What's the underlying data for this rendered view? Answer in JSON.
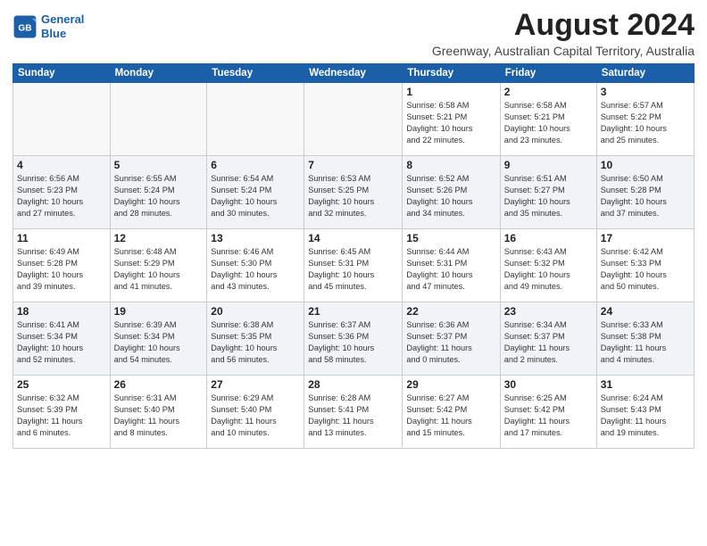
{
  "title": "August 2024",
  "subtitle": "Greenway, Australian Capital Territory, Australia",
  "logo": {
    "line1": "General",
    "line2": "Blue"
  },
  "days_of_week": [
    "Sunday",
    "Monday",
    "Tuesday",
    "Wednesday",
    "Thursday",
    "Friday",
    "Saturday"
  ],
  "weeks": [
    [
      {
        "day": "",
        "info": ""
      },
      {
        "day": "",
        "info": ""
      },
      {
        "day": "",
        "info": ""
      },
      {
        "day": "",
        "info": ""
      },
      {
        "day": "1",
        "info": "Sunrise: 6:58 AM\nSunset: 5:21 PM\nDaylight: 10 hours\nand 22 minutes."
      },
      {
        "day": "2",
        "info": "Sunrise: 6:58 AM\nSunset: 5:21 PM\nDaylight: 10 hours\nand 23 minutes."
      },
      {
        "day": "3",
        "info": "Sunrise: 6:57 AM\nSunset: 5:22 PM\nDaylight: 10 hours\nand 25 minutes."
      }
    ],
    [
      {
        "day": "4",
        "info": "Sunrise: 6:56 AM\nSunset: 5:23 PM\nDaylight: 10 hours\nand 27 minutes."
      },
      {
        "day": "5",
        "info": "Sunrise: 6:55 AM\nSunset: 5:24 PM\nDaylight: 10 hours\nand 28 minutes."
      },
      {
        "day": "6",
        "info": "Sunrise: 6:54 AM\nSunset: 5:24 PM\nDaylight: 10 hours\nand 30 minutes."
      },
      {
        "day": "7",
        "info": "Sunrise: 6:53 AM\nSunset: 5:25 PM\nDaylight: 10 hours\nand 32 minutes."
      },
      {
        "day": "8",
        "info": "Sunrise: 6:52 AM\nSunset: 5:26 PM\nDaylight: 10 hours\nand 34 minutes."
      },
      {
        "day": "9",
        "info": "Sunrise: 6:51 AM\nSunset: 5:27 PM\nDaylight: 10 hours\nand 35 minutes."
      },
      {
        "day": "10",
        "info": "Sunrise: 6:50 AM\nSunset: 5:28 PM\nDaylight: 10 hours\nand 37 minutes."
      }
    ],
    [
      {
        "day": "11",
        "info": "Sunrise: 6:49 AM\nSunset: 5:28 PM\nDaylight: 10 hours\nand 39 minutes."
      },
      {
        "day": "12",
        "info": "Sunrise: 6:48 AM\nSunset: 5:29 PM\nDaylight: 10 hours\nand 41 minutes."
      },
      {
        "day": "13",
        "info": "Sunrise: 6:46 AM\nSunset: 5:30 PM\nDaylight: 10 hours\nand 43 minutes."
      },
      {
        "day": "14",
        "info": "Sunrise: 6:45 AM\nSunset: 5:31 PM\nDaylight: 10 hours\nand 45 minutes."
      },
      {
        "day": "15",
        "info": "Sunrise: 6:44 AM\nSunset: 5:31 PM\nDaylight: 10 hours\nand 47 minutes."
      },
      {
        "day": "16",
        "info": "Sunrise: 6:43 AM\nSunset: 5:32 PM\nDaylight: 10 hours\nand 49 minutes."
      },
      {
        "day": "17",
        "info": "Sunrise: 6:42 AM\nSunset: 5:33 PM\nDaylight: 10 hours\nand 50 minutes."
      }
    ],
    [
      {
        "day": "18",
        "info": "Sunrise: 6:41 AM\nSunset: 5:34 PM\nDaylight: 10 hours\nand 52 minutes."
      },
      {
        "day": "19",
        "info": "Sunrise: 6:39 AM\nSunset: 5:34 PM\nDaylight: 10 hours\nand 54 minutes."
      },
      {
        "day": "20",
        "info": "Sunrise: 6:38 AM\nSunset: 5:35 PM\nDaylight: 10 hours\nand 56 minutes."
      },
      {
        "day": "21",
        "info": "Sunrise: 6:37 AM\nSunset: 5:36 PM\nDaylight: 10 hours\nand 58 minutes."
      },
      {
        "day": "22",
        "info": "Sunrise: 6:36 AM\nSunset: 5:37 PM\nDaylight: 11 hours\nand 0 minutes."
      },
      {
        "day": "23",
        "info": "Sunrise: 6:34 AM\nSunset: 5:37 PM\nDaylight: 11 hours\nand 2 minutes."
      },
      {
        "day": "24",
        "info": "Sunrise: 6:33 AM\nSunset: 5:38 PM\nDaylight: 11 hours\nand 4 minutes."
      }
    ],
    [
      {
        "day": "25",
        "info": "Sunrise: 6:32 AM\nSunset: 5:39 PM\nDaylight: 11 hours\nand 6 minutes."
      },
      {
        "day": "26",
        "info": "Sunrise: 6:31 AM\nSunset: 5:40 PM\nDaylight: 11 hours\nand 8 minutes."
      },
      {
        "day": "27",
        "info": "Sunrise: 6:29 AM\nSunset: 5:40 PM\nDaylight: 11 hours\nand 10 minutes."
      },
      {
        "day": "28",
        "info": "Sunrise: 6:28 AM\nSunset: 5:41 PM\nDaylight: 11 hours\nand 13 minutes."
      },
      {
        "day": "29",
        "info": "Sunrise: 6:27 AM\nSunset: 5:42 PM\nDaylight: 11 hours\nand 15 minutes."
      },
      {
        "day": "30",
        "info": "Sunrise: 6:25 AM\nSunset: 5:42 PM\nDaylight: 11 hours\nand 17 minutes."
      },
      {
        "day": "31",
        "info": "Sunrise: 6:24 AM\nSunset: 5:43 PM\nDaylight: 11 hours\nand 19 minutes."
      }
    ]
  ]
}
